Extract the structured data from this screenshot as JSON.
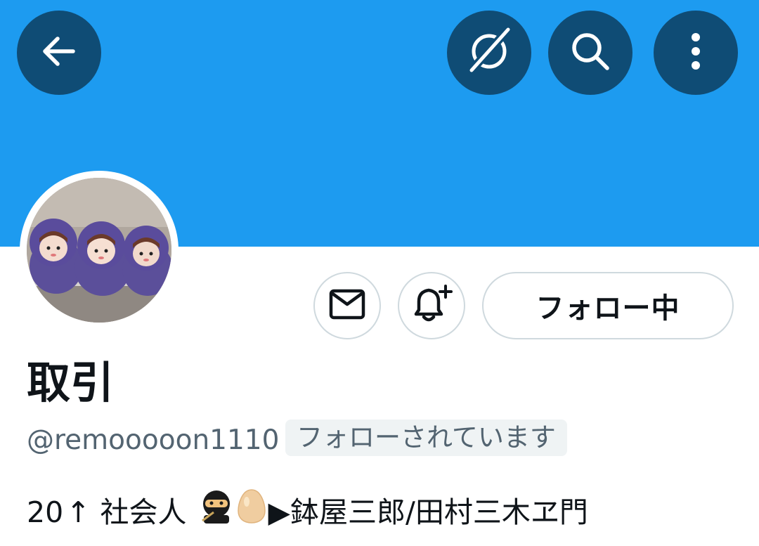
{
  "header": {
    "back_icon": "arrow-left-icon",
    "grok_icon": "grok-slash-icon",
    "search_icon": "search-icon",
    "more_icon": "more-vertical-icon",
    "banner_color": "#1d9bf0",
    "button_color": "#0f4c75"
  },
  "profile": {
    "avatar_icon": "avatar-image",
    "message_icon": "envelope-icon",
    "notify_icon": "bell-plus-icon",
    "follow_label": "フォロー中",
    "name": "取引",
    "handle": "@remooooon1110",
    "follows_you": "フォローされています",
    "bio_part1": "20",
    "bio_arrow": "↑",
    "bio_part2": "社会人",
    "bio_part3": "▶鉢屋三郎/田村三木ヱ門"
  }
}
